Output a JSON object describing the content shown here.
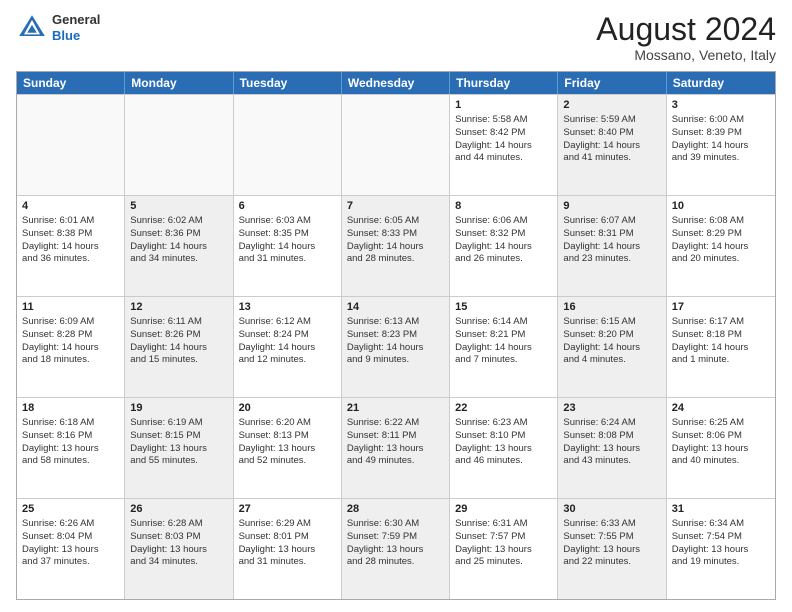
{
  "header": {
    "logo_line1": "General",
    "logo_line2": "Blue",
    "main_title": "August 2024",
    "sub_title": "Mossano, Veneto, Italy"
  },
  "days_of_week": [
    "Sunday",
    "Monday",
    "Tuesday",
    "Wednesday",
    "Thursday",
    "Friday",
    "Saturday"
  ],
  "rows": [
    [
      {
        "day": "",
        "info": "",
        "shaded": false,
        "empty": true
      },
      {
        "day": "",
        "info": "",
        "shaded": false,
        "empty": true
      },
      {
        "day": "",
        "info": "",
        "shaded": false,
        "empty": true
      },
      {
        "day": "",
        "info": "",
        "shaded": false,
        "empty": true
      },
      {
        "day": "1",
        "info": "Sunrise: 5:58 AM\nSunset: 8:42 PM\nDaylight: 14 hours\nand 44 minutes.",
        "shaded": false,
        "empty": false
      },
      {
        "day": "2",
        "info": "Sunrise: 5:59 AM\nSunset: 8:40 PM\nDaylight: 14 hours\nand 41 minutes.",
        "shaded": true,
        "empty": false
      },
      {
        "day": "3",
        "info": "Sunrise: 6:00 AM\nSunset: 8:39 PM\nDaylight: 14 hours\nand 39 minutes.",
        "shaded": false,
        "empty": false
      }
    ],
    [
      {
        "day": "4",
        "info": "Sunrise: 6:01 AM\nSunset: 8:38 PM\nDaylight: 14 hours\nand 36 minutes.",
        "shaded": false,
        "empty": false
      },
      {
        "day": "5",
        "info": "Sunrise: 6:02 AM\nSunset: 8:36 PM\nDaylight: 14 hours\nand 34 minutes.",
        "shaded": true,
        "empty": false
      },
      {
        "day": "6",
        "info": "Sunrise: 6:03 AM\nSunset: 8:35 PM\nDaylight: 14 hours\nand 31 minutes.",
        "shaded": false,
        "empty": false
      },
      {
        "day": "7",
        "info": "Sunrise: 6:05 AM\nSunset: 8:33 PM\nDaylight: 14 hours\nand 28 minutes.",
        "shaded": true,
        "empty": false
      },
      {
        "day": "8",
        "info": "Sunrise: 6:06 AM\nSunset: 8:32 PM\nDaylight: 14 hours\nand 26 minutes.",
        "shaded": false,
        "empty": false
      },
      {
        "day": "9",
        "info": "Sunrise: 6:07 AM\nSunset: 8:31 PM\nDaylight: 14 hours\nand 23 minutes.",
        "shaded": true,
        "empty": false
      },
      {
        "day": "10",
        "info": "Sunrise: 6:08 AM\nSunset: 8:29 PM\nDaylight: 14 hours\nand 20 minutes.",
        "shaded": false,
        "empty": false
      }
    ],
    [
      {
        "day": "11",
        "info": "Sunrise: 6:09 AM\nSunset: 8:28 PM\nDaylight: 14 hours\nand 18 minutes.",
        "shaded": false,
        "empty": false
      },
      {
        "day": "12",
        "info": "Sunrise: 6:11 AM\nSunset: 8:26 PM\nDaylight: 14 hours\nand 15 minutes.",
        "shaded": true,
        "empty": false
      },
      {
        "day": "13",
        "info": "Sunrise: 6:12 AM\nSunset: 8:24 PM\nDaylight: 14 hours\nand 12 minutes.",
        "shaded": false,
        "empty": false
      },
      {
        "day": "14",
        "info": "Sunrise: 6:13 AM\nSunset: 8:23 PM\nDaylight: 14 hours\nand 9 minutes.",
        "shaded": true,
        "empty": false
      },
      {
        "day": "15",
        "info": "Sunrise: 6:14 AM\nSunset: 8:21 PM\nDaylight: 14 hours\nand 7 minutes.",
        "shaded": false,
        "empty": false
      },
      {
        "day": "16",
        "info": "Sunrise: 6:15 AM\nSunset: 8:20 PM\nDaylight: 14 hours\nand 4 minutes.",
        "shaded": true,
        "empty": false
      },
      {
        "day": "17",
        "info": "Sunrise: 6:17 AM\nSunset: 8:18 PM\nDaylight: 14 hours\nand 1 minute.",
        "shaded": false,
        "empty": false
      }
    ],
    [
      {
        "day": "18",
        "info": "Sunrise: 6:18 AM\nSunset: 8:16 PM\nDaylight: 13 hours\nand 58 minutes.",
        "shaded": false,
        "empty": false
      },
      {
        "day": "19",
        "info": "Sunrise: 6:19 AM\nSunset: 8:15 PM\nDaylight: 13 hours\nand 55 minutes.",
        "shaded": true,
        "empty": false
      },
      {
        "day": "20",
        "info": "Sunrise: 6:20 AM\nSunset: 8:13 PM\nDaylight: 13 hours\nand 52 minutes.",
        "shaded": false,
        "empty": false
      },
      {
        "day": "21",
        "info": "Sunrise: 6:22 AM\nSunset: 8:11 PM\nDaylight: 13 hours\nand 49 minutes.",
        "shaded": true,
        "empty": false
      },
      {
        "day": "22",
        "info": "Sunrise: 6:23 AM\nSunset: 8:10 PM\nDaylight: 13 hours\nand 46 minutes.",
        "shaded": false,
        "empty": false
      },
      {
        "day": "23",
        "info": "Sunrise: 6:24 AM\nSunset: 8:08 PM\nDaylight: 13 hours\nand 43 minutes.",
        "shaded": true,
        "empty": false
      },
      {
        "day": "24",
        "info": "Sunrise: 6:25 AM\nSunset: 8:06 PM\nDaylight: 13 hours\nand 40 minutes.",
        "shaded": false,
        "empty": false
      }
    ],
    [
      {
        "day": "25",
        "info": "Sunrise: 6:26 AM\nSunset: 8:04 PM\nDaylight: 13 hours\nand 37 minutes.",
        "shaded": false,
        "empty": false
      },
      {
        "day": "26",
        "info": "Sunrise: 6:28 AM\nSunset: 8:03 PM\nDaylight: 13 hours\nand 34 minutes.",
        "shaded": true,
        "empty": false
      },
      {
        "day": "27",
        "info": "Sunrise: 6:29 AM\nSunset: 8:01 PM\nDaylight: 13 hours\nand 31 minutes.",
        "shaded": false,
        "empty": false
      },
      {
        "day": "28",
        "info": "Sunrise: 6:30 AM\nSunset: 7:59 PM\nDaylight: 13 hours\nand 28 minutes.",
        "shaded": true,
        "empty": false
      },
      {
        "day": "29",
        "info": "Sunrise: 6:31 AM\nSunset: 7:57 PM\nDaylight: 13 hours\nand 25 minutes.",
        "shaded": false,
        "empty": false
      },
      {
        "day": "30",
        "info": "Sunrise: 6:33 AM\nSunset: 7:55 PM\nDaylight: 13 hours\nand 22 minutes.",
        "shaded": true,
        "empty": false
      },
      {
        "day": "31",
        "info": "Sunrise: 6:34 AM\nSunset: 7:54 PM\nDaylight: 13 hours\nand 19 minutes.",
        "shaded": false,
        "empty": false
      }
    ]
  ]
}
